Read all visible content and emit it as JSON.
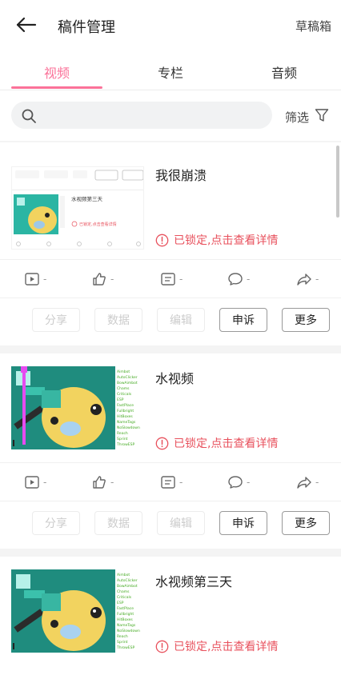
{
  "header": {
    "title": "稿件管理",
    "drafts_label": "草稿箱"
  },
  "tabs": [
    {
      "label": "视频",
      "active": true
    },
    {
      "label": "专栏",
      "active": false
    },
    {
      "label": "音频",
      "active": false
    }
  ],
  "search": {
    "placeholder": ""
  },
  "filter": {
    "label": "筛选"
  },
  "locked_text": "已锁定,点击查看详情",
  "stat_placeholder": "-",
  "actions": [
    "分享",
    "数据",
    "编辑",
    "申诉",
    "更多"
  ],
  "videos": [
    {
      "title": "我很崩溃",
      "thumb_caption": "水视频第三天",
      "thumb_locked": "已锁定,点击查看详情"
    },
    {
      "title": "水视频"
    },
    {
      "title": "水视频第三天"
    }
  ],
  "colors": {
    "accent": "#fb7299",
    "locked": "#e8515d",
    "disabled": "#cccccc"
  }
}
